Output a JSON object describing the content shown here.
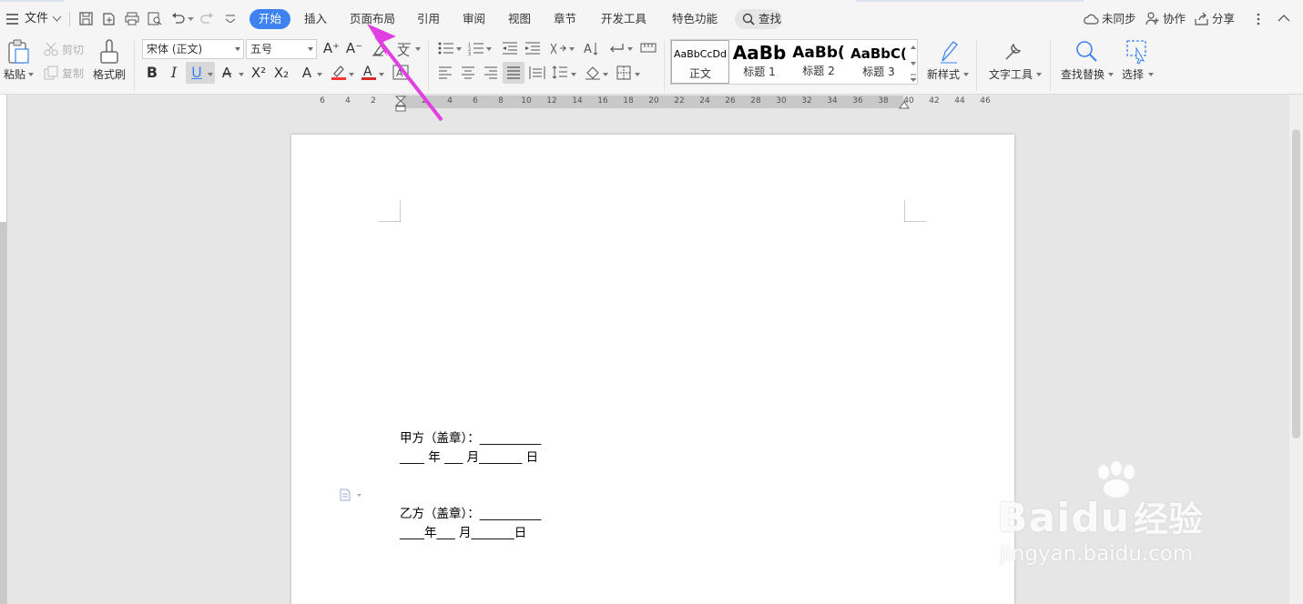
{
  "titlebar": {
    "menu_file": "文件",
    "tabs": [
      "开始",
      "插入",
      "页面布局",
      "引用",
      "审阅",
      "视图",
      "章节",
      "开发工具",
      "特色功能"
    ],
    "search_label": "查找",
    "sync_status": "未同步",
    "collaborate": "协作",
    "share": "分享"
  },
  "ribbon": {
    "paste": "粘贴",
    "cut": "剪切",
    "copy": "复制",
    "format_painter": "格式刷",
    "font_name": "宋体 (正文)",
    "font_size": "五号",
    "styles": [
      {
        "preview": "AaBbCcDd",
        "name": "正文"
      },
      {
        "preview": "AaBb",
        "name": "标题 1"
      },
      {
        "preview": "AaBb(",
        "name": "标题 2"
      },
      {
        "preview": "AaBbC(",
        "name": "标题 3"
      }
    ],
    "new_style": "新样式",
    "text_tools": "文字工具",
    "find_replace": "查找替换",
    "select": "选择"
  },
  "ruler": {
    "ticks": [
      "6",
      "4",
      "2",
      "",
      "2",
      "4",
      "6",
      "8",
      "10",
      "12",
      "14",
      "16",
      "18",
      "20",
      "22",
      "24",
      "26",
      "28",
      "30",
      "32",
      "34",
      "36",
      "38",
      "40",
      "42",
      "44",
      "46"
    ]
  },
  "document": {
    "lines": [
      "甲方（盖章）：__________",
      "____ 年 ___ 月_______ 日",
      "乙方（盖章）：__________",
      "____年___ 月_______日"
    ]
  },
  "watermark": {
    "brand": "Baidu",
    "brand_cn": "经验",
    "url": "jingyan.baidu.com"
  },
  "colors": {
    "accent": "#3d82f0",
    "annotation_arrow": "#e040e0",
    "font_color_bar": "#d62b2b"
  }
}
